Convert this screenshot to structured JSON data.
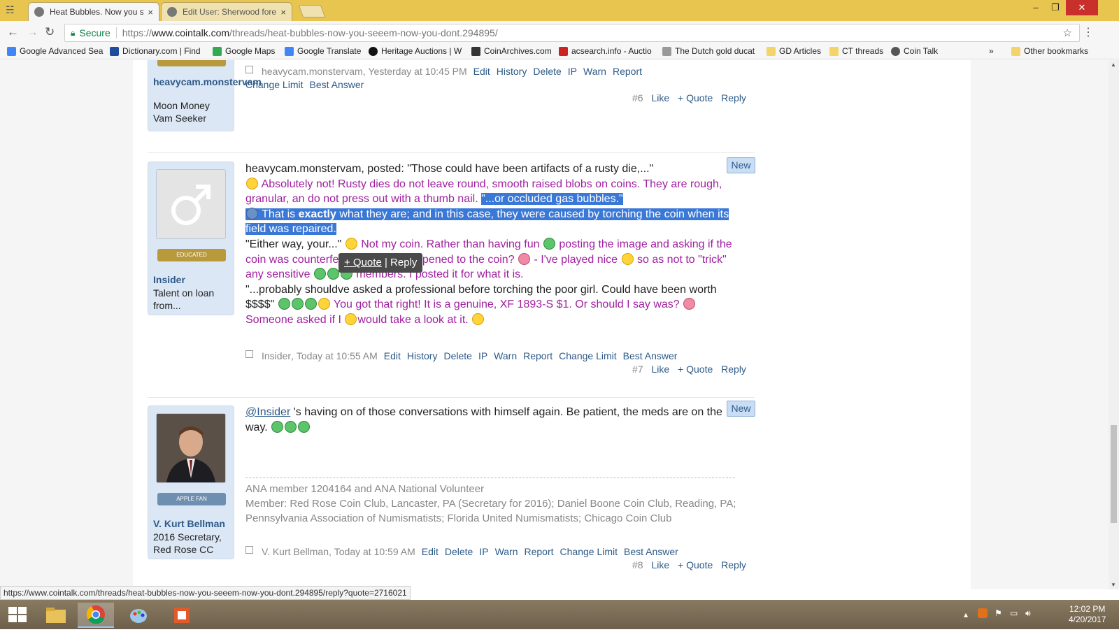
{
  "browser": {
    "tabs": [
      {
        "title": "Heat Bubbles. Now you s",
        "close": "×"
      },
      {
        "title": "Edit User: Sherwood fore",
        "close": "×"
      }
    ],
    "window_controls": {
      "minimize": "–",
      "maximize": "❐",
      "close": "✕"
    },
    "address": {
      "secure_label": "Secure",
      "url_prefix": "https://",
      "url_host": "www.cointalk.com",
      "url_path": "/threads/heat-bubbles-now-you-seeem-now-you-dont.294895/"
    },
    "bookmarks": [
      {
        "label": "Google Advanced Sea",
        "icon_color": "#4285f4"
      },
      {
        "label": "Dictionary.com | Find",
        "icon_color": "#1c4e9c"
      },
      {
        "label": "Google Maps",
        "icon_color": "#34a853"
      },
      {
        "label": "Google Translate",
        "icon_color": "#4285f4"
      },
      {
        "label": "Heritage Auctions | W",
        "icon_color": "#111111"
      },
      {
        "label": "CoinArchives.com",
        "icon_color": "#333333"
      },
      {
        "label": "acsearch.info - Auctio",
        "icon_color": "#cc2222"
      },
      {
        "label": "The Dutch gold ducat",
        "icon_color": "#999999"
      },
      {
        "label": "GD Articles",
        "icon_color": "#f2d46b"
      },
      {
        "label": "CT threads",
        "icon_color": "#f2d46b"
      },
      {
        "label": "Coin Talk",
        "icon_color": "#555555"
      }
    ],
    "bookmarks_more": "»",
    "other_bookmarks": "Other bookmarks"
  },
  "posts": [
    {
      "user": {
        "name": "heavycam.monstervam",
        "title": "Moon Money Vam Seeker"
      },
      "meta": {
        "author": "heavycam.monstervam",
        "time": "Yesterday at 10:45 PM",
        "links": [
          "Edit",
          "History",
          "Delete",
          "IP",
          "Warn",
          "Report",
          "Change Limit",
          "Best Answer"
        ]
      },
      "actions": {
        "num": "#6",
        "like": "Like",
        "quote": "+ Quote",
        "reply": "Reply"
      }
    },
    {
      "user": {
        "name": "Insider",
        "title": "Talent on loan from...",
        "badge": "EDUCATED"
      },
      "new": "New",
      "body": {
        "l1": "heavycam.monstervam, posted: \"Those could have been artifacts of a rusty die,...\"",
        "l2a": "Absolutely not! Rusty dies do not leave round, smooth raised blobs on coins. They are rough, granular, an do not press out with a thumb nail.",
        "l2b": "\"...or occluded gas bubbles.\"",
        "l3a": "That is ",
        "l3b": "exactly",
        "l3c": " what they are; and in this case, they were caused by torching the coin when its field was repaired.",
        "l4a": "\"Either way, your...\"",
        "l4b": "Not my coin. Rather than having fun",
        "l4c": "posting the image and asking if the coin was counterfeit",
        "l4d": "or what happened to the coin?",
        "l4e": "- I've played nice",
        "l4f": "so as not to \"trick\" any sensitive",
        "l4g": "members. I posted it for what it is.",
        "l5a": "\"...probably shouldve asked a professional before torching the poor girl. Could have been worth $$$$\"",
        "l5b": "You got that right! It is a genuine, XF 1893-S $1. Or should I say was?",
        "l5c": "Someone asked if I",
        "l5d": "would take a look at it."
      },
      "tooltip": {
        "quote": "+ Quote",
        "sep": "|",
        "reply": "Reply"
      },
      "meta": {
        "author": "Insider",
        "time": "Today at 10:55 AM",
        "links": [
          "Edit",
          "History",
          "Delete",
          "IP",
          "Warn",
          "Report",
          "Change Limit",
          "Best Answer"
        ]
      },
      "actions": {
        "num": "#7",
        "like": "Like",
        "quote": "+ Quote",
        "reply": "Reply"
      }
    },
    {
      "user": {
        "name": "V. Kurt Bellman",
        "title": "2016 Secretary, Red Rose CC",
        "badge": "APPLE FAN"
      },
      "new": "New",
      "body": {
        "mention": "@Insider",
        "text": " 's having on of those conversations with himself again. Be patient, the meds are on the way."
      },
      "signature": [
        "ANA member 1204164 and ANA National Volunteer",
        "Member: Red Rose Coin Club, Lancaster, PA (Secretary for 2016); Daniel Boone Coin Club, Reading, PA; Pennsylvania Association of Numismatists; Florida United Numismatists; Chicago Coin Club"
      ],
      "meta": {
        "author": "V. Kurt Bellman",
        "time": "Today at 10:59 AM",
        "links": [
          "Edit",
          "Delete",
          "IP",
          "Warn",
          "Report",
          "Change Limit",
          "Best Answer"
        ]
      },
      "actions": {
        "num": "#8",
        "like": "Like",
        "quote": "+ Quote",
        "reply": "Reply"
      }
    }
  ],
  "status_url": "https://www.cointalk.com/threads/heat-bubbles-now-you-seeem-now-you-dont.294895/reply?quote=2716021",
  "taskbar": {
    "time": "12:02 PM",
    "date": "4/20/2017"
  }
}
